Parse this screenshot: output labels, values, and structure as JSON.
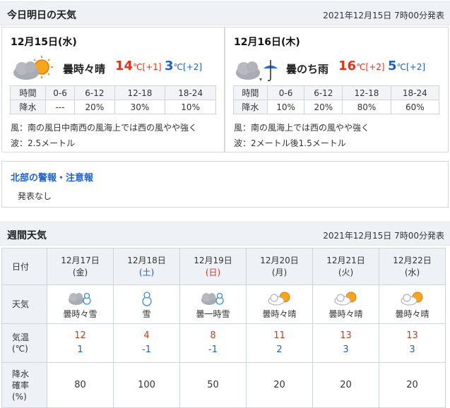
{
  "today_section": {
    "title": "今日明日の天気",
    "issued": "2021年12月15日 7時00分発表"
  },
  "days": [
    {
      "date": "12月15日(水)",
      "weather": "曇時々晴",
      "icon": "cloud-sun-icon",
      "high": "14",
      "high_diff": "[+1]",
      "low": "3",
      "low_diff": "[+2]",
      "unit": "℃",
      "pop_header": [
        "時間",
        "0-6",
        "6-12",
        "12-18",
        "18-24"
      ],
      "pop_row": [
        "降水",
        "---",
        "20%",
        "30%",
        "10%"
      ],
      "wind": "風：南の風日中南西の風海上では西の風やや強く",
      "wave": "波：2.5メートル"
    },
    {
      "date": "12月16日(木)",
      "weather": "曇のち雨",
      "icon": "cloud-then-rain-icon",
      "high": "16",
      "high_diff": "[+2]",
      "low": "5",
      "low_diff": "[+2]",
      "unit": "℃",
      "pop_header": [
        "時間",
        "0-6",
        "6-12",
        "12-18",
        "18-24"
      ],
      "pop_row": [
        "降水",
        "10%",
        "20%",
        "80%",
        "60%"
      ],
      "wind": "風：南の風海上では西の風やや強く",
      "wave": "波：2メートル後1.5メートル"
    }
  ],
  "warning": {
    "title": "北部の警報・注意報",
    "text": "発表なし"
  },
  "weekly_section": {
    "title": "週間天気",
    "issued": "2021年12月15日 7時00分発表"
  },
  "weekly": {
    "row_labels": {
      "date": "日付",
      "weather": "天気",
      "temp_line1": "気温",
      "temp_line2": "(℃)",
      "pop_line1": "降水",
      "pop_line2": "確率",
      "pop_line3": "(%)"
    },
    "days": [
      {
        "date": "12月17日",
        "dow": "(金)",
        "dow_type": "weekday",
        "icon": "cloud-snow-icon",
        "weather": "曇時々雪",
        "high": "12",
        "low": "1",
        "pop": "80"
      },
      {
        "date": "12月18日",
        "dow": "(土)",
        "dow_type": "sat",
        "icon": "snow-icon",
        "weather": "雪",
        "high": "4",
        "low": "-1",
        "pop": "100"
      },
      {
        "date": "12月19日",
        "dow": "(日)",
        "dow_type": "sun",
        "icon": "cloud-snow-icon",
        "weather": "曇一時雪",
        "high": "8",
        "low": "-1",
        "pop": "50"
      },
      {
        "date": "12月20日",
        "dow": "(月)",
        "dow_type": "weekday",
        "icon": "cloud-sun-icon",
        "weather": "曇時々晴",
        "high": "11",
        "low": "2",
        "pop": "20"
      },
      {
        "date": "12月21日",
        "dow": "(火)",
        "dow_type": "weekday",
        "icon": "cloud-sun-icon",
        "weather": "曇時々晴",
        "high": "13",
        "low": "3",
        "pop": "20"
      },
      {
        "date": "12月22日",
        "dow": "(水)",
        "dow_type": "weekday",
        "icon": "cloud-sun-icon",
        "weather": "曇時々晴",
        "high": "13",
        "low": "3",
        "pop": "20"
      }
    ]
  },
  "colors": {
    "high": "#e0331c",
    "low": "#1f5fcf",
    "header_bg": "#eef1f6",
    "link_blue": "#1f5fcf"
  }
}
